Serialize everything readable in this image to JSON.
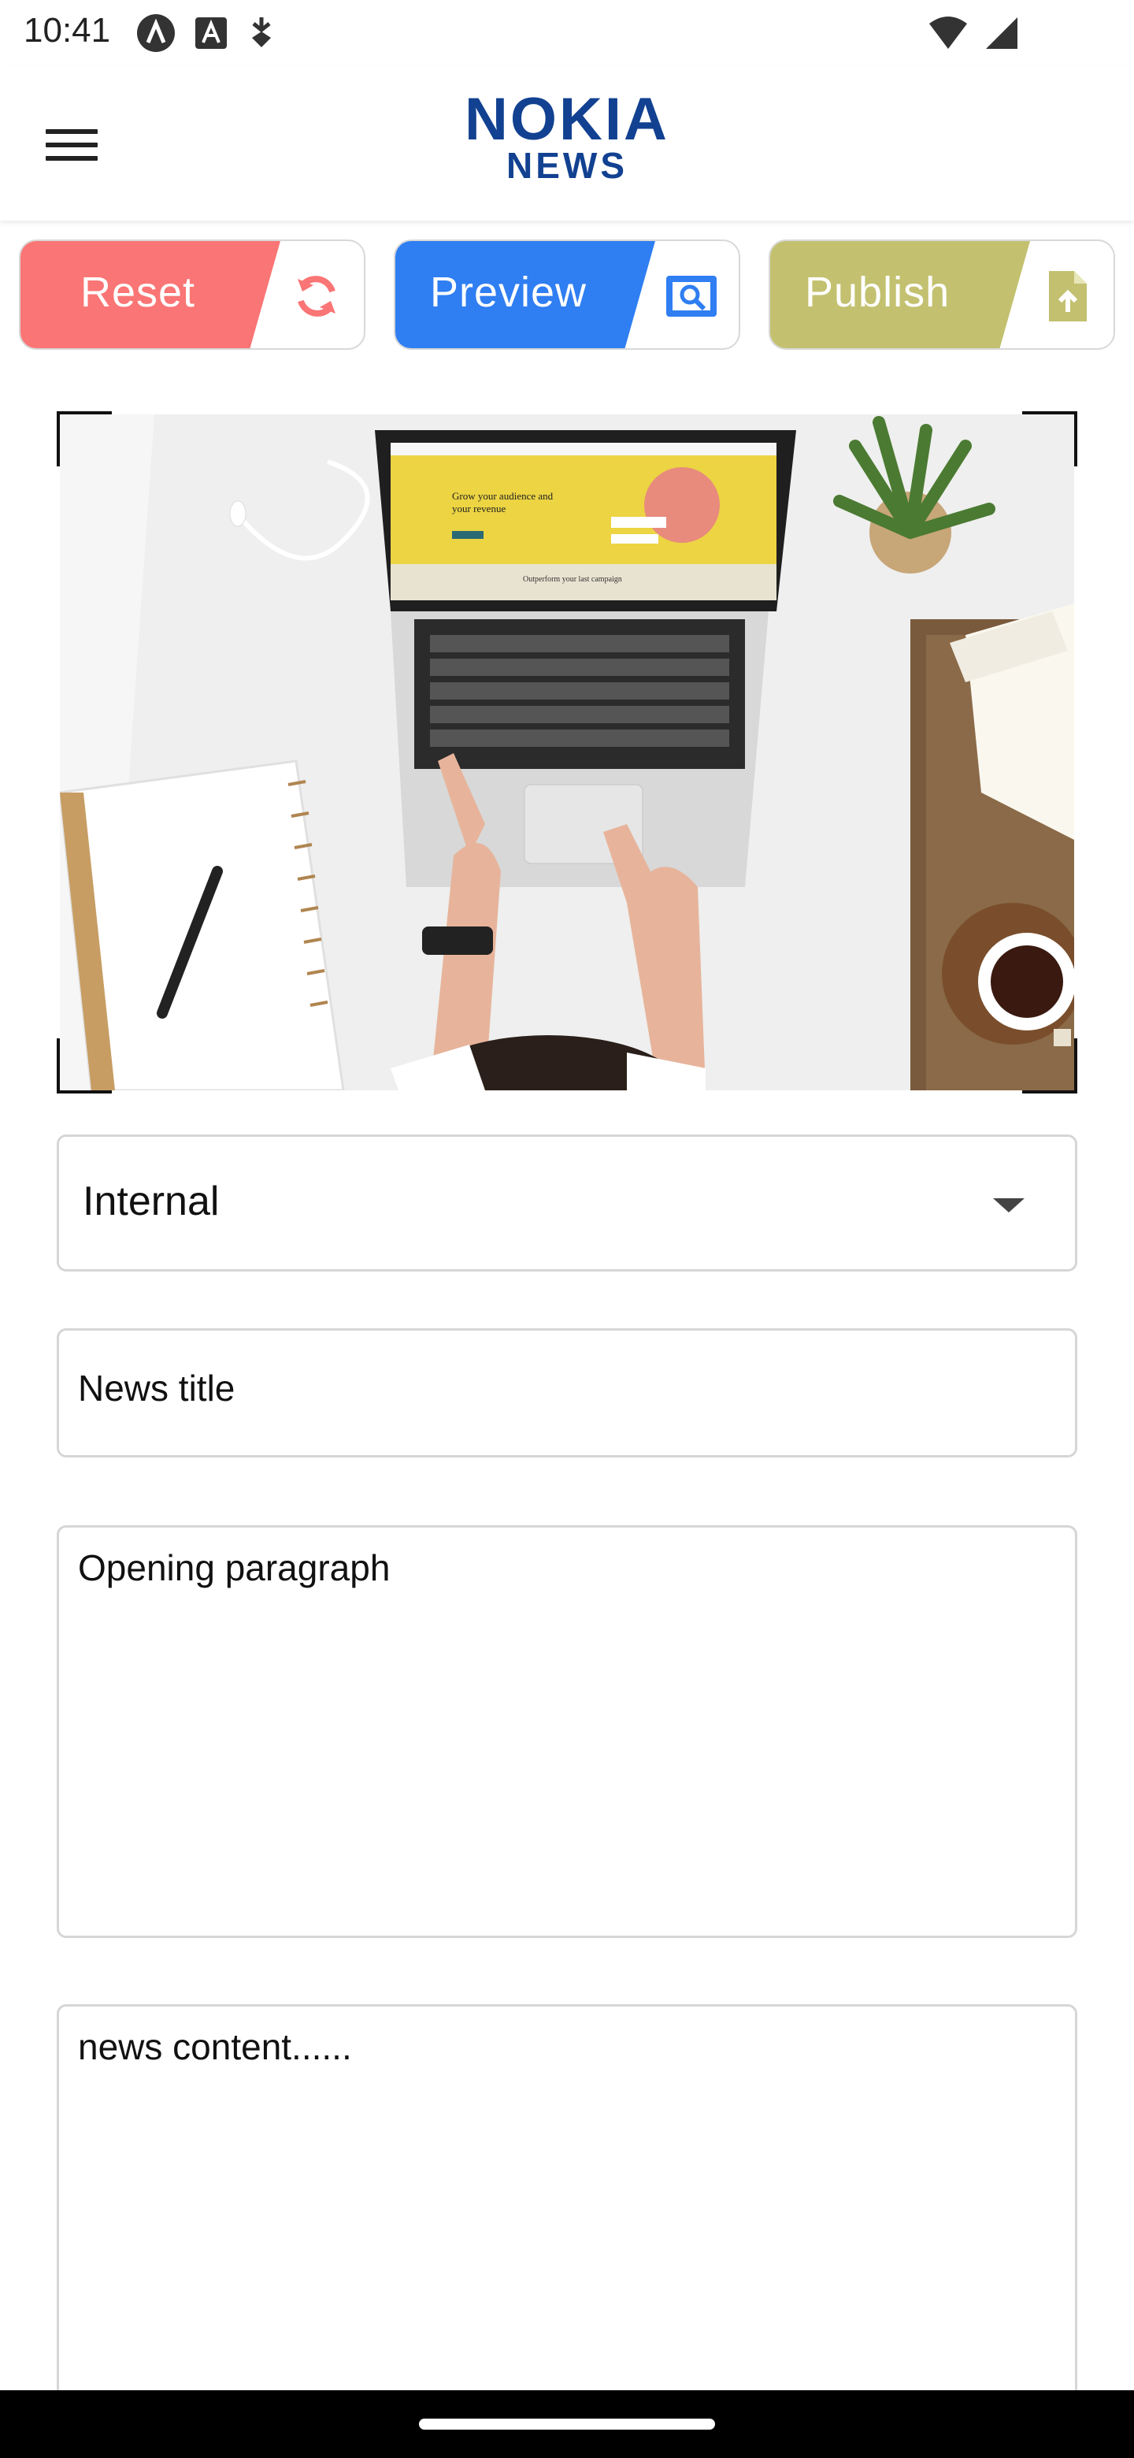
{
  "status_bar": {
    "time": "10:41",
    "icons": [
      "app-a-icon",
      "font-a-icon",
      "sync-icon",
      "wifi-icon",
      "signal-icon"
    ]
  },
  "header": {
    "logo_top": "NOKIA",
    "logo_bottom": "NEWS",
    "brand_color": "#124191",
    "menu_icon": "hamburger-menu-icon"
  },
  "actions": {
    "reset": {
      "label": "Reset",
      "color": "#fa7575",
      "icon": "refresh-icon"
    },
    "preview": {
      "label": "Preview",
      "color": "#2f7ef2",
      "icon": "preview-icon"
    },
    "publish": {
      "label": "Publish",
      "color": "#c3c170",
      "icon": "publish-file-icon"
    }
  },
  "image": {
    "subject": "laptop-workspace-photo",
    "laptop_screen_text_1": "Grow your audience and",
    "laptop_screen_text_2": "your revenue",
    "laptop_screen_text_3": "Outperform your last campaign"
  },
  "form": {
    "category": {
      "value": "Internal",
      "icon": "dropdown-arrow-icon"
    },
    "title": {
      "placeholder": "News title"
    },
    "opening": {
      "placeholder": "Opening paragraph"
    },
    "content": {
      "placeholder": "news content......"
    }
  }
}
